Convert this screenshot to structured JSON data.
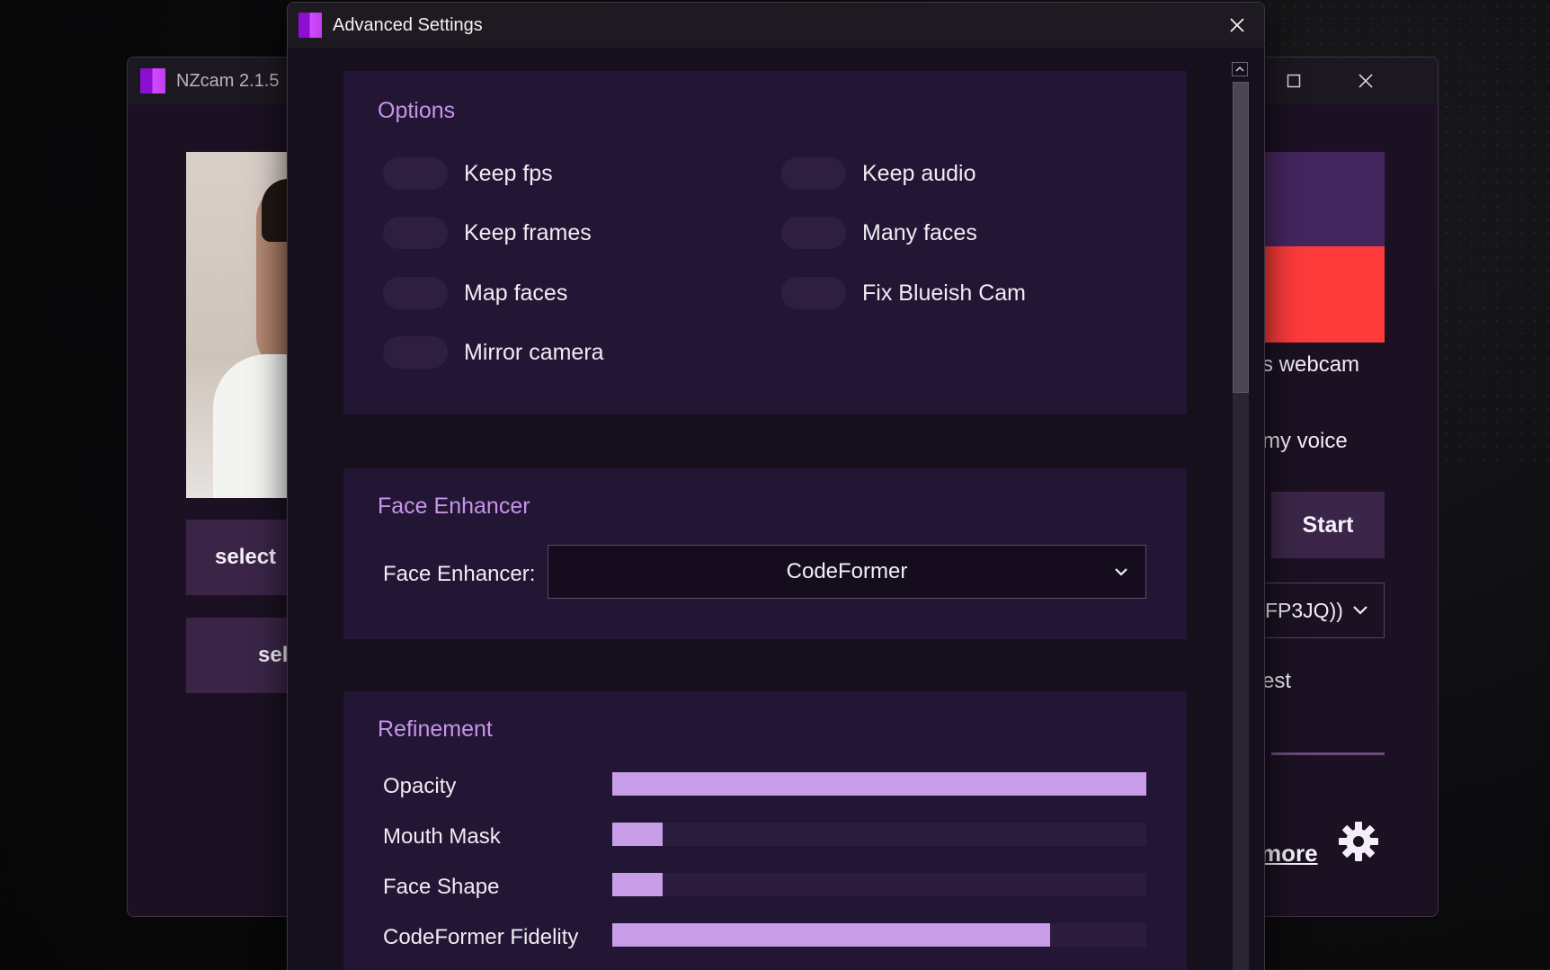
{
  "main_window": {
    "title": "NZcam 2.1.5",
    "buttons": {
      "select_face": "select",
      "select_target": "sel"
    },
    "webcam_label": "s webcam",
    "voice_label": "my voice",
    "start_label": "Start",
    "camera_select_value": "FP3JQ))",
    "quality_label": "est",
    "more_link": "more",
    "colors": {
      "accent_purple": "#44265f",
      "accent_red": "#fd3b3b"
    }
  },
  "dialog": {
    "title": "Advanced Settings",
    "options": {
      "title": "Options",
      "items": [
        {
          "label": "Keep fps",
          "enabled": false
        },
        {
          "label": "Keep audio",
          "enabled": false
        },
        {
          "label": "Keep frames",
          "enabled": false
        },
        {
          "label": "Many faces",
          "enabled": false
        },
        {
          "label": "Map faces",
          "enabled": false
        },
        {
          "label": "Fix Blueish Cam",
          "enabled": false
        },
        {
          "label": "Mirror camera",
          "enabled": false
        }
      ]
    },
    "face_enhancer": {
      "title": "Face Enhancer",
      "label": "Face Enhancer:",
      "selected": "CodeFormer"
    },
    "refinement": {
      "title": "Refinement",
      "sliders": [
        {
          "label": "Opacity",
          "value": 1.0
        },
        {
          "label": "Mouth Mask",
          "value": 0.095
        },
        {
          "label": "Face Shape",
          "value": 0.095
        },
        {
          "label": "CodeFormer Fidelity",
          "value": 0.82
        }
      ]
    }
  }
}
